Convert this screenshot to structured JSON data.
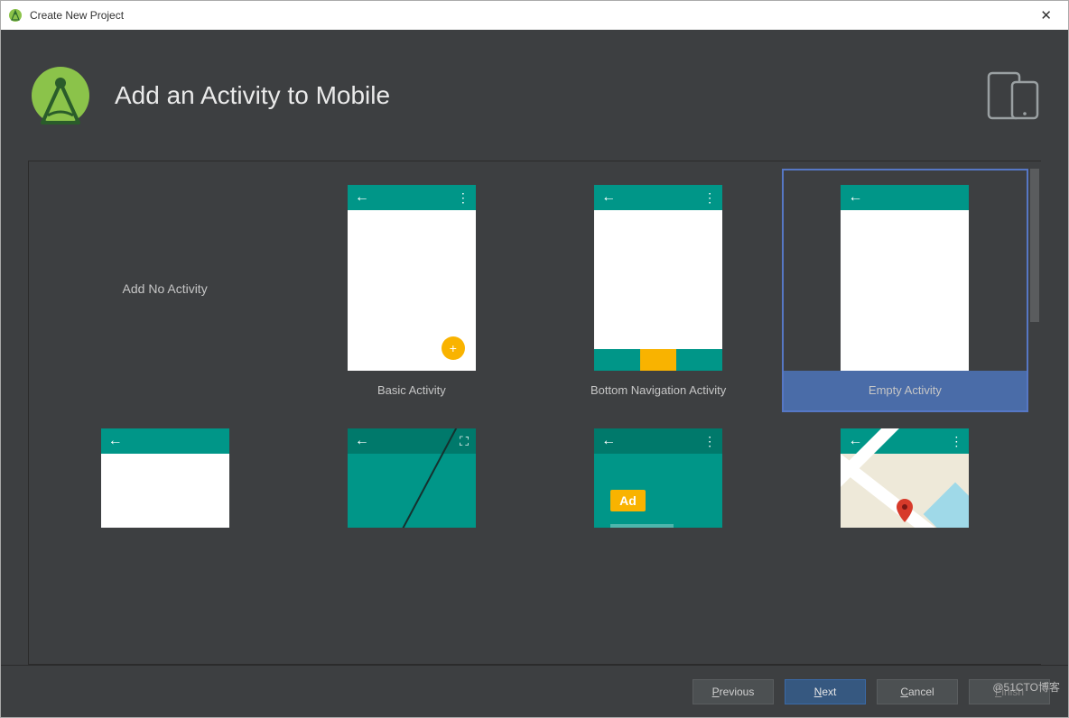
{
  "window": {
    "title": "Create New Project"
  },
  "header": {
    "title": "Add an Activity to Mobile"
  },
  "templates": {
    "row1": [
      {
        "kind": "none",
        "label": "Add No Activity"
      },
      {
        "kind": "basic",
        "label": "Basic Activity"
      },
      {
        "kind": "bottom",
        "label": "Bottom Navigation Activity"
      },
      {
        "kind": "empty",
        "label": "Empty Activity",
        "selected": true
      }
    ],
    "row2": [
      {
        "kind": "fullscreen",
        "label": ""
      },
      {
        "kind": "fullscreen2",
        "label": ""
      },
      {
        "kind": "ad",
        "label": ""
      },
      {
        "kind": "map",
        "label": ""
      }
    ]
  },
  "ad_text": "Ad",
  "footer": {
    "previous": "Previous",
    "next": "Next",
    "cancel": "Cancel",
    "finish": "Finish"
  },
  "watermark": "@51CTO博客"
}
